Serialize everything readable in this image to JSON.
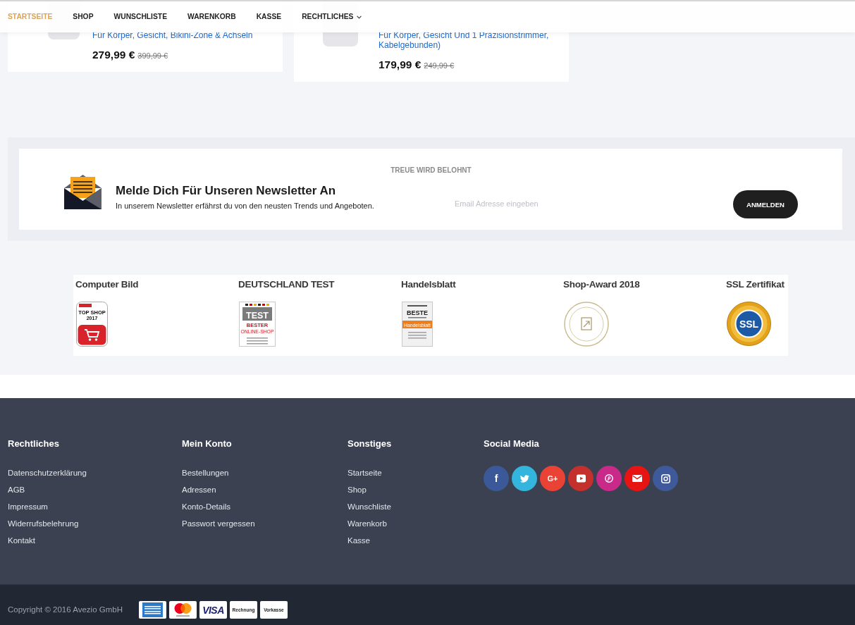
{
  "nav": {
    "items": [
      {
        "label": "STARTSEITE",
        "selected": true,
        "menu": false
      },
      {
        "label": "SHOP",
        "selected": false,
        "menu": false
      },
      {
        "label": "WUNSCHLISTE",
        "selected": false,
        "menu": false
      },
      {
        "label": "WARENKORB",
        "selected": false,
        "menu": false
      },
      {
        "label": "KASSE",
        "selected": false,
        "menu": false
      },
      {
        "label": "RECHTLICHES",
        "selected": false,
        "menu": true
      }
    ]
  },
  "products": [
    {
      "title": "Für Körper, Gesicht, Bikini-Zone & Achseln",
      "price": "279,99 €",
      "old_price": "399,99 €"
    },
    {
      "title": "Für Körper, Gesicht Und 1 Präzisionstrimmer, Kabelgebunden)",
      "price": "179,99 €",
      "old_price": "249,99 €"
    }
  ],
  "newsletter": {
    "tagline": "TREUE WIRD BELOHNT",
    "heading": "Melde Dich Für Unseren Newsletter An",
    "text": "In unserem Newsletter erfährst du von den neusten Trends und Angeboten.",
    "email": {
      "placeholder": "Email Adresse eingeben"
    },
    "button": "ANMELDEN"
  },
  "awards": [
    {
      "title": "Computer Bild",
      "kind": "computer-bild",
      "seal": [
        "TOP SHOP",
        "2017"
      ]
    },
    {
      "title": "DEUTSCHLAND TEST",
      "kind": "deutschland-test",
      "seal": [
        "TEST",
        "BESTER",
        "ONLINE-SHOP"
      ]
    },
    {
      "title": "Handelsblatt",
      "kind": "handelsblatt",
      "seal": [
        "BESTE",
        "Handelsblatt"
      ]
    },
    {
      "title": "Shop-Award 2018",
      "kind": "shop-award"
    },
    {
      "title": "SSL Zertifikat",
      "kind": "ssl",
      "seal": [
        "SSL"
      ]
    }
  ],
  "footer": {
    "columns": [
      {
        "heading": "Rechtliches",
        "links": [
          "Datenschutzerklärung",
          "AGB",
          "Impressum",
          "Widerrufsbelehrung",
          "Kontakt"
        ]
      },
      {
        "heading": "Mein Konto",
        "links": [
          "Bestellungen",
          "Adressen",
          "Konto-Details",
          "Passwort vergessen"
        ]
      },
      {
        "heading": "Sonstiges",
        "links": [
          "Startseite",
          "Shop",
          "Wunschliste",
          "Warenkorb",
          "Kasse"
        ]
      }
    ],
    "social": {
      "heading": "Social Media",
      "links": [
        {
          "kind": "facebook",
          "glyph": "f",
          "color": "#3b5998"
        },
        {
          "kind": "twitter",
          "color": "#33b5dd"
        },
        {
          "kind": "google-plus",
          "glyph": "G+",
          "color": "#ea4335"
        },
        {
          "kind": "youtube",
          "color": "#c4302b"
        },
        {
          "kind": "pinterest",
          "color": "#c92a8a"
        },
        {
          "kind": "email",
          "color": "#e81313"
        },
        {
          "kind": "instagram",
          "color": "#3f5a9a"
        }
      ]
    }
  },
  "bottom_bar": {
    "copyright": "Copyright © 2016 Avezio GmbH",
    "payments": [
      {
        "kind": "amex"
      },
      {
        "kind": "mastercard"
      },
      {
        "kind": "visa",
        "label": "VISA"
      },
      {
        "kind": "text",
        "label": "Rechnung"
      },
      {
        "kind": "text",
        "label": "Vorkasse"
      }
    ]
  }
}
